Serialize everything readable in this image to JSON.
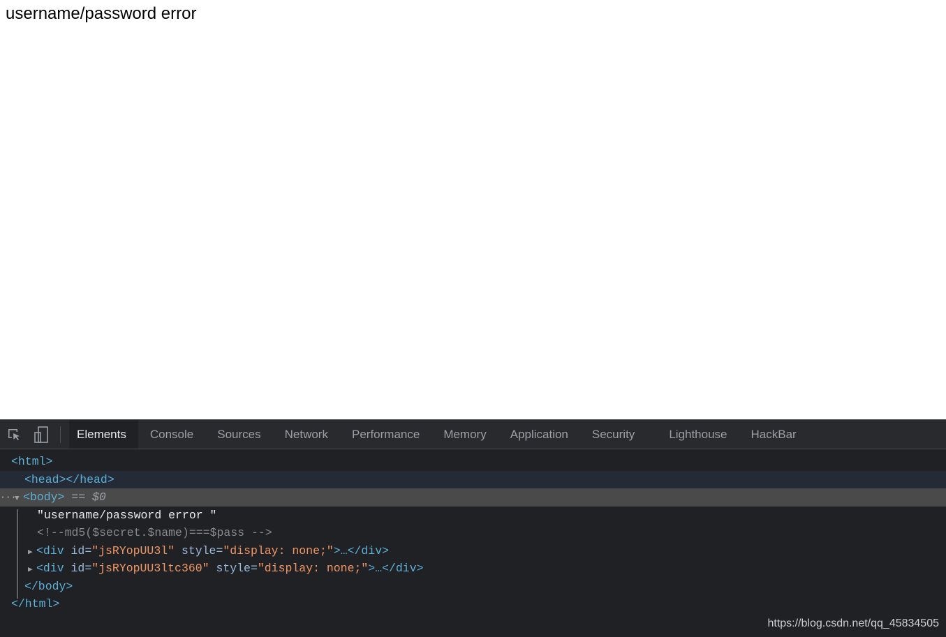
{
  "page": {
    "text": "username/password error"
  },
  "devtools": {
    "tabs": [
      {
        "label": "Elements",
        "active": true
      },
      {
        "label": "Console"
      },
      {
        "label": "Sources"
      },
      {
        "label": "Network"
      },
      {
        "label": "Performance"
      },
      {
        "label": "Memory"
      },
      {
        "label": "Application"
      },
      {
        "label": "Security"
      },
      {
        "label": "Lighthouse"
      },
      {
        "label": "HackBar"
      }
    ],
    "tree": {
      "html_open": "<html>",
      "head": "<head></head>",
      "body_open": "<body>",
      "body_eq": " == ",
      "body_ref": "$0",
      "text_node": "\"username/password error \"",
      "comment": "<!--md5($secret.$name)===$pass -->",
      "divs": [
        {
          "open": "<div",
          "id_attr": " id=",
          "id_val": "\"jsRYopUU3l\"",
          "style_attr": " style=",
          "style_val": "\"display: none;\"",
          "close": ">…</div>"
        },
        {
          "open": "<div",
          "id_attr": " id=",
          "id_val": "\"jsRYopUU3ltc360\"",
          "style_attr": " style=",
          "style_val": "\"display: none;\"",
          "close": ">…</div>"
        }
      ],
      "body_close": "</body>",
      "html_close": "</html>"
    }
  },
  "watermark": "https://blog.csdn.net/qq_45834505"
}
